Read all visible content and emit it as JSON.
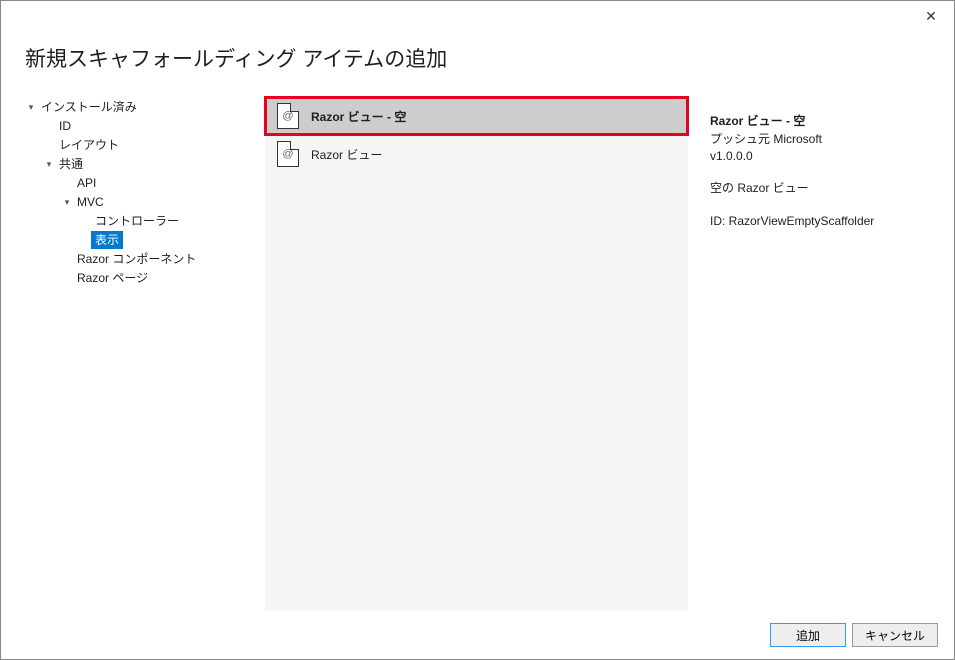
{
  "dialog": {
    "title": "新規スキャフォールディング アイテムの追加",
    "close": "✕"
  },
  "tree": {
    "items": [
      {
        "label": "インストール済み",
        "indent": 0,
        "arrow": "down",
        "selected": false
      },
      {
        "label": "ID",
        "indent": 1,
        "arrow": "none",
        "selected": false
      },
      {
        "label": "レイアウト",
        "indent": 1,
        "arrow": "none",
        "selected": false
      },
      {
        "label": "共通",
        "indent": 1,
        "arrow": "down",
        "selected": false
      },
      {
        "label": "API",
        "indent": 2,
        "arrow": "none",
        "selected": false
      },
      {
        "label": "MVC",
        "indent": 2,
        "arrow": "down",
        "selected": false
      },
      {
        "label": "コントローラー",
        "indent": 3,
        "arrow": "none",
        "selected": false
      },
      {
        "label": "表示",
        "indent": 3,
        "arrow": "none",
        "selected": true
      },
      {
        "label": "Razor コンポーネント",
        "indent": 2,
        "arrow": "none",
        "selected": false
      },
      {
        "label": "Razor ページ",
        "indent": 2,
        "arrow": "none",
        "selected": false
      }
    ]
  },
  "list": {
    "items": [
      {
        "label": "Razor ビュー - 空",
        "selected": true,
        "highlighted": true,
        "icon": "@"
      },
      {
        "label": "Razor ビュー",
        "selected": false,
        "highlighted": false,
        "icon": "@"
      }
    ]
  },
  "detail": {
    "title": "Razor ビュー - 空",
    "publisher": "プッシュ元 Microsoft",
    "version": "v1.0.0.0",
    "description": "空の Razor ビュー",
    "id_label": "ID: RazorViewEmptyScaffolder"
  },
  "footer": {
    "add": "追加",
    "cancel": "キャンセル"
  }
}
